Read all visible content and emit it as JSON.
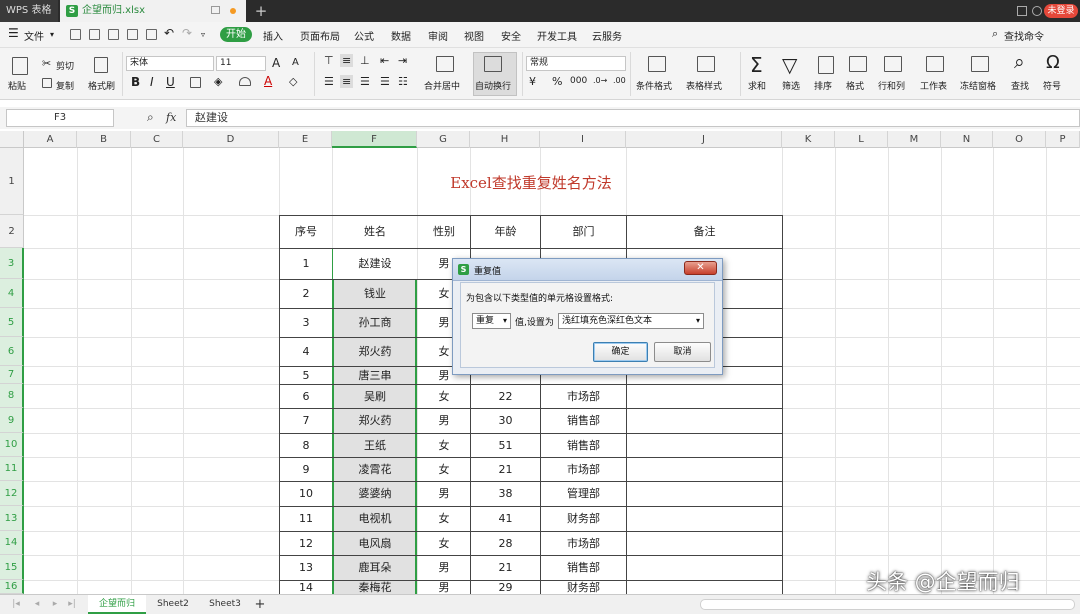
{
  "titlebar": {
    "app_tab": "WPS 表格",
    "file_tab": "企望而归.xlsx",
    "new_tab": "+",
    "login_badge": "未登录"
  },
  "menubar": {
    "file_menu": "文件",
    "start": "开始",
    "items": [
      "插入",
      "页面布局",
      "公式",
      "数据",
      "审阅",
      "视图",
      "安全",
      "开发工具",
      "云服务"
    ],
    "search_command": "查找命令"
  },
  "ribbon": {
    "paste": "粘贴",
    "cut": "剪切",
    "copy": "复制",
    "format_painter": "格式刷",
    "font_name": "宋体",
    "font_size": "11",
    "merge_center": "合并居中",
    "wrap_text": "自动换行",
    "number_format": "常规",
    "conditional_format": "条件格式",
    "table_style": "表格样式",
    "sum": "求和",
    "filter": "筛选",
    "sort": "排序",
    "format": "格式",
    "rows_cols": "行和列",
    "worksheet": "工作表",
    "freeze": "冻结窗格",
    "find": "查找",
    "symbol": "符号"
  },
  "formula_bar": {
    "name_box": "F3",
    "fx": "fx",
    "content": "赵建设"
  },
  "columns": [
    "A",
    "B",
    "C",
    "D",
    "E",
    "F",
    "G",
    "H",
    "I",
    "J",
    "K",
    "L",
    "M",
    "N",
    "O",
    "P"
  ],
  "rows": [
    "1",
    "2",
    "3",
    "4",
    "5",
    "6",
    "7",
    "8",
    "9",
    "10",
    "11",
    "12",
    "13",
    "14",
    "15",
    "16"
  ],
  "sheet": {
    "title": "Excel查找重复姓名方法",
    "headers": [
      "序号",
      "姓名",
      "性别",
      "年龄",
      "部门",
      "备注"
    ],
    "data": [
      [
        "1",
        "赵建设",
        "男",
        "",
        ""
      ],
      [
        "2",
        "钱业",
        "女",
        "",
        ""
      ],
      [
        "3",
        "孙工商",
        "男",
        "",
        ""
      ],
      [
        "4",
        "郑火药",
        "女",
        "",
        ""
      ],
      [
        "5",
        "唐三串",
        "男",
        "",
        ""
      ],
      [
        "6",
        "吴刷",
        "女",
        "22",
        "市场部"
      ],
      [
        "7",
        "郑火药",
        "男",
        "30",
        "销售部"
      ],
      [
        "8",
        "王纸",
        "女",
        "51",
        "销售部"
      ],
      [
        "9",
        "凌霄花",
        "女",
        "21",
        "市场部"
      ],
      [
        "10",
        "婆婆纳",
        "男",
        "38",
        "管理部"
      ],
      [
        "11",
        "电视机",
        "女",
        "41",
        "财务部"
      ],
      [
        "12",
        "电风扇",
        "女",
        "28",
        "市场部"
      ],
      [
        "13",
        "鹿耳朵",
        "男",
        "21",
        "销售部"
      ],
      [
        "14",
        "秦梅花",
        "男",
        "29",
        "财务部"
      ]
    ]
  },
  "dialog": {
    "title": "重复值",
    "prompt": "为包含以下类型值的单元格设置格式:",
    "type_select": "重复",
    "value_label": "值,设置为",
    "style_select": "浅红填充色深红色文本",
    "ok": "确定",
    "cancel": "取消"
  },
  "sheet_tabs": [
    "企望而归",
    "Sheet2",
    "Sheet3"
  ],
  "add_sheet": "+",
  "watermark": "头条 @企望而归",
  "colors": {
    "title_red": "#c0392b",
    "selection_green": "#2f9e44",
    "wps_green": "#2f9e44"
  }
}
